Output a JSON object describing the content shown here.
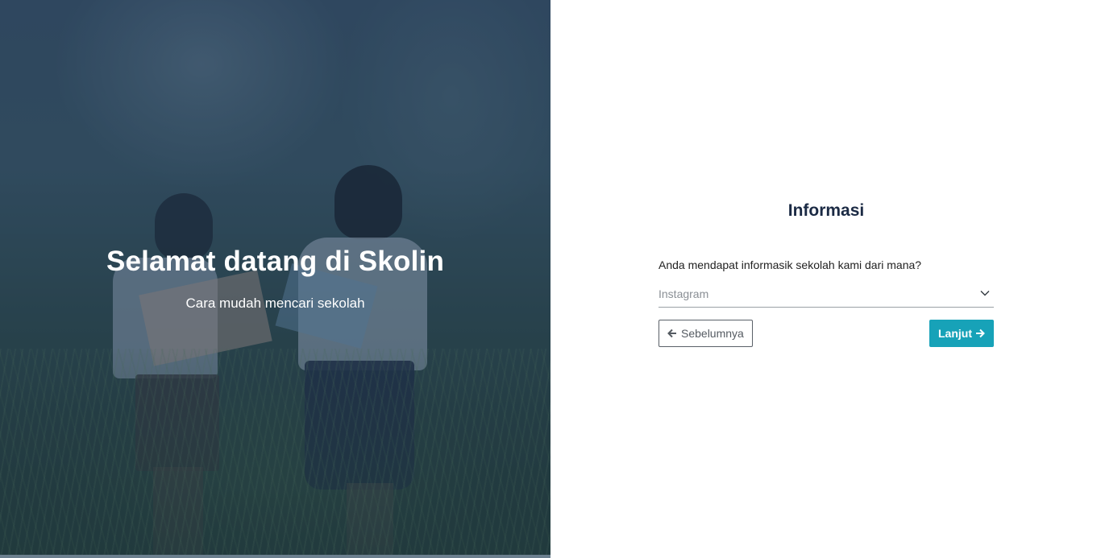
{
  "hero": {
    "title": "Selamat datang di Skolin",
    "subtitle": "Cara mudah mencari sekolah"
  },
  "form": {
    "title": "Informasi",
    "question": "Anda mendapat informasik sekolah kami dari mana?",
    "select": {
      "selected": "Instagram"
    },
    "prev_label": "Sebelumnya",
    "next_label": "Lanjut"
  },
  "colors": {
    "accent": "#17a2b8",
    "title": "#1b2a44",
    "hero_overlay": "#1e3755"
  },
  "icons": {
    "prev": "arrow-left-icon",
    "next": "arrow-right-icon",
    "select": "chevron-down-icon"
  }
}
